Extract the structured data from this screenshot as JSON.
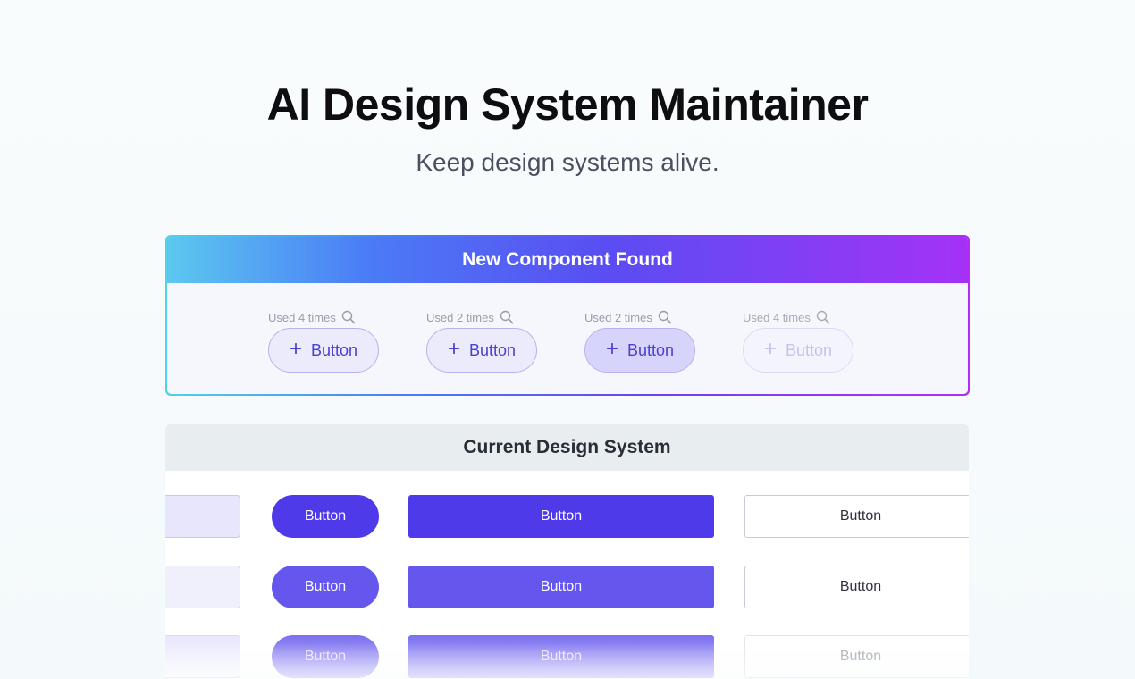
{
  "hero": {
    "title": "AI Design System Maintainer",
    "subtitle": "Keep design systems alive."
  },
  "new_component": {
    "header": "New Component Found",
    "candidates": [
      {
        "usage": "Used 4 times",
        "label": "Button",
        "icon": "plus-icon"
      },
      {
        "usage": "Used 2 times",
        "label": "Button",
        "icon": "plus-icon"
      },
      {
        "usage": "Used 2 times",
        "label": "Button",
        "icon": "plus-icon"
      },
      {
        "usage": "Used 4 times",
        "label": "Button",
        "icon": "plus-icon"
      }
    ]
  },
  "current_system": {
    "header": "Current Design System",
    "rows": [
      {
        "pill": "Button",
        "wide": "Button",
        "outline": "Button"
      },
      {
        "pill": "Button",
        "wide": "Button",
        "outline": "Button"
      },
      {
        "pill": "Button",
        "wide": "Button",
        "outline": "Button"
      }
    ]
  },
  "colors": {
    "primary": "#4f3ae9",
    "gradient_start": "#4fd3e8",
    "gradient_end": "#b12df5"
  }
}
